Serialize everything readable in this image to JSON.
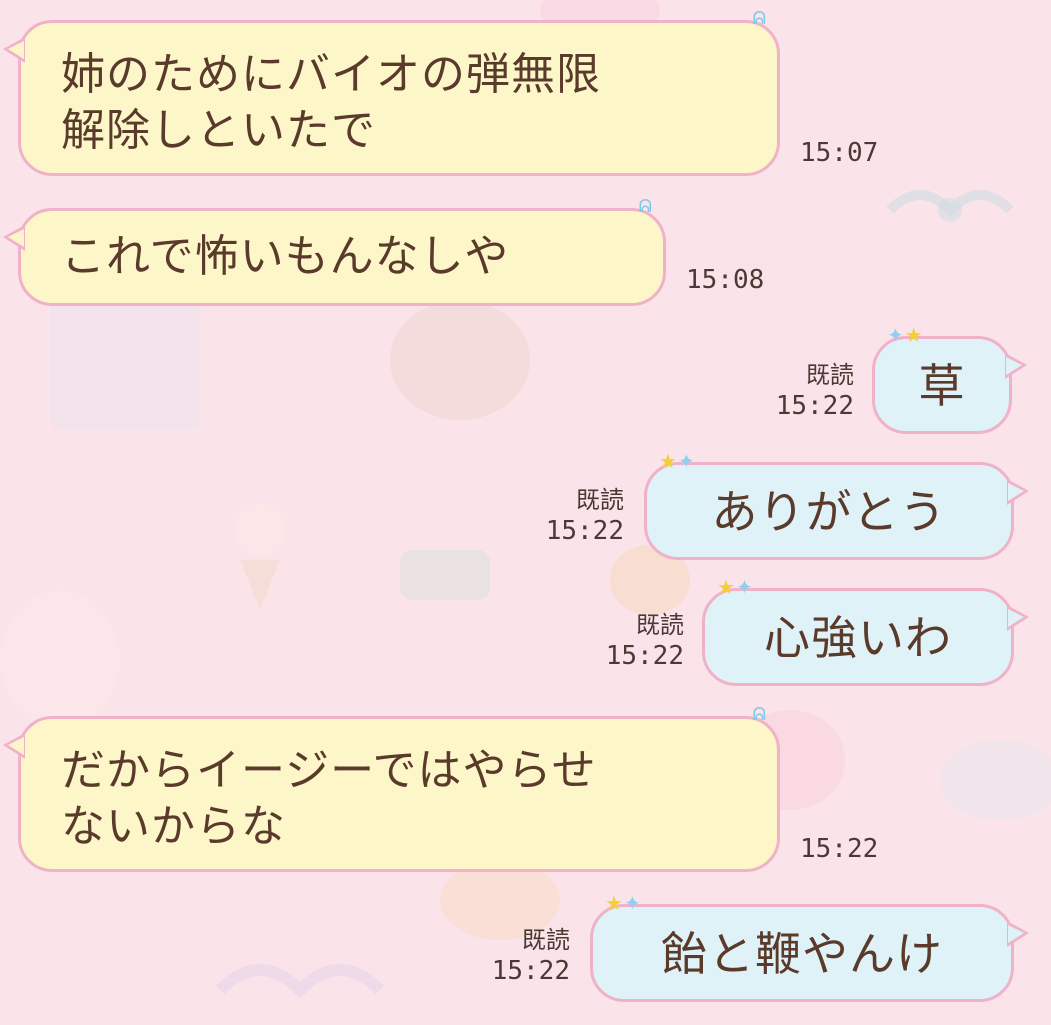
{
  "messages": [
    {
      "side": "received",
      "text_lines": [
        "姉のためにバイオの弾無限",
        "解除しといたで"
      ],
      "time": "15:07"
    },
    {
      "side": "received",
      "text": "これで怖いもんなしや",
      "time": "15:08"
    },
    {
      "side": "sent",
      "text": "草",
      "read": "既読",
      "time": "15:22"
    },
    {
      "side": "sent",
      "text": "ありがとう",
      "read": "既読",
      "time": "15:22"
    },
    {
      "side": "sent",
      "text": "心強いわ",
      "read": "既読",
      "time": "15:22"
    },
    {
      "side": "received",
      "text_lines": [
        "だからイージーではやらせ",
        "ないからな"
      ],
      "time": "15:22"
    },
    {
      "side": "sent",
      "text": "飴と鞭やんけ",
      "read": "既読",
      "time": "15:22"
    }
  ],
  "colors": {
    "background": "#fbe3ea",
    "received_bubble": "#fdf6c9",
    "sent_bubble": "#dff2f8",
    "bubble_border": "#f0b2c8",
    "text": "#5a3a2a"
  },
  "icons": [
    "ribbon-icon",
    "star-sticker-icon"
  ]
}
